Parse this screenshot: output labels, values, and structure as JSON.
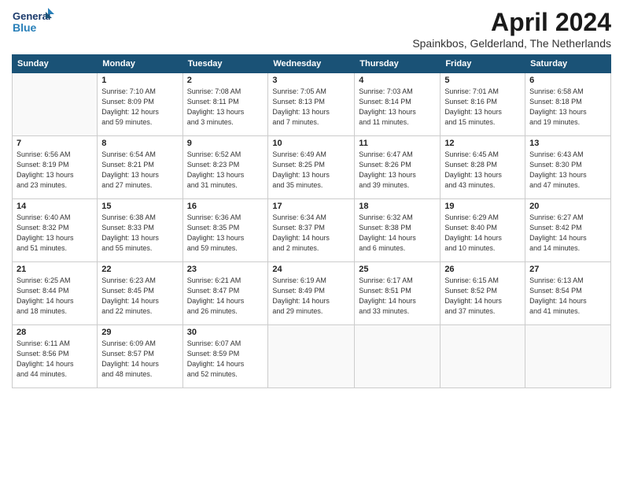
{
  "header": {
    "logo_line1": "General",
    "logo_line2": "Blue",
    "month": "April 2024",
    "location": "Spainkbos, Gelderland, The Netherlands"
  },
  "days_of_week": [
    "Sunday",
    "Monday",
    "Tuesday",
    "Wednesday",
    "Thursday",
    "Friday",
    "Saturday"
  ],
  "weeks": [
    [
      {
        "day": "",
        "info": ""
      },
      {
        "day": "1",
        "info": "Sunrise: 7:10 AM\nSunset: 8:09 PM\nDaylight: 12 hours\nand 59 minutes."
      },
      {
        "day": "2",
        "info": "Sunrise: 7:08 AM\nSunset: 8:11 PM\nDaylight: 13 hours\nand 3 minutes."
      },
      {
        "day": "3",
        "info": "Sunrise: 7:05 AM\nSunset: 8:13 PM\nDaylight: 13 hours\nand 7 minutes."
      },
      {
        "day": "4",
        "info": "Sunrise: 7:03 AM\nSunset: 8:14 PM\nDaylight: 13 hours\nand 11 minutes."
      },
      {
        "day": "5",
        "info": "Sunrise: 7:01 AM\nSunset: 8:16 PM\nDaylight: 13 hours\nand 15 minutes."
      },
      {
        "day": "6",
        "info": "Sunrise: 6:58 AM\nSunset: 8:18 PM\nDaylight: 13 hours\nand 19 minutes."
      }
    ],
    [
      {
        "day": "7",
        "info": "Sunrise: 6:56 AM\nSunset: 8:19 PM\nDaylight: 13 hours\nand 23 minutes."
      },
      {
        "day": "8",
        "info": "Sunrise: 6:54 AM\nSunset: 8:21 PM\nDaylight: 13 hours\nand 27 minutes."
      },
      {
        "day": "9",
        "info": "Sunrise: 6:52 AM\nSunset: 8:23 PM\nDaylight: 13 hours\nand 31 minutes."
      },
      {
        "day": "10",
        "info": "Sunrise: 6:49 AM\nSunset: 8:25 PM\nDaylight: 13 hours\nand 35 minutes."
      },
      {
        "day": "11",
        "info": "Sunrise: 6:47 AM\nSunset: 8:26 PM\nDaylight: 13 hours\nand 39 minutes."
      },
      {
        "day": "12",
        "info": "Sunrise: 6:45 AM\nSunset: 8:28 PM\nDaylight: 13 hours\nand 43 minutes."
      },
      {
        "day": "13",
        "info": "Sunrise: 6:43 AM\nSunset: 8:30 PM\nDaylight: 13 hours\nand 47 minutes."
      }
    ],
    [
      {
        "day": "14",
        "info": "Sunrise: 6:40 AM\nSunset: 8:32 PM\nDaylight: 13 hours\nand 51 minutes."
      },
      {
        "day": "15",
        "info": "Sunrise: 6:38 AM\nSunset: 8:33 PM\nDaylight: 13 hours\nand 55 minutes."
      },
      {
        "day": "16",
        "info": "Sunrise: 6:36 AM\nSunset: 8:35 PM\nDaylight: 13 hours\nand 59 minutes."
      },
      {
        "day": "17",
        "info": "Sunrise: 6:34 AM\nSunset: 8:37 PM\nDaylight: 14 hours\nand 2 minutes."
      },
      {
        "day": "18",
        "info": "Sunrise: 6:32 AM\nSunset: 8:38 PM\nDaylight: 14 hours\nand 6 minutes."
      },
      {
        "day": "19",
        "info": "Sunrise: 6:29 AM\nSunset: 8:40 PM\nDaylight: 14 hours\nand 10 minutes."
      },
      {
        "day": "20",
        "info": "Sunrise: 6:27 AM\nSunset: 8:42 PM\nDaylight: 14 hours\nand 14 minutes."
      }
    ],
    [
      {
        "day": "21",
        "info": "Sunrise: 6:25 AM\nSunset: 8:44 PM\nDaylight: 14 hours\nand 18 minutes."
      },
      {
        "day": "22",
        "info": "Sunrise: 6:23 AM\nSunset: 8:45 PM\nDaylight: 14 hours\nand 22 minutes."
      },
      {
        "day": "23",
        "info": "Sunrise: 6:21 AM\nSunset: 8:47 PM\nDaylight: 14 hours\nand 26 minutes."
      },
      {
        "day": "24",
        "info": "Sunrise: 6:19 AM\nSunset: 8:49 PM\nDaylight: 14 hours\nand 29 minutes."
      },
      {
        "day": "25",
        "info": "Sunrise: 6:17 AM\nSunset: 8:51 PM\nDaylight: 14 hours\nand 33 minutes."
      },
      {
        "day": "26",
        "info": "Sunrise: 6:15 AM\nSunset: 8:52 PM\nDaylight: 14 hours\nand 37 minutes."
      },
      {
        "day": "27",
        "info": "Sunrise: 6:13 AM\nSunset: 8:54 PM\nDaylight: 14 hours\nand 41 minutes."
      }
    ],
    [
      {
        "day": "28",
        "info": "Sunrise: 6:11 AM\nSunset: 8:56 PM\nDaylight: 14 hours\nand 44 minutes."
      },
      {
        "day": "29",
        "info": "Sunrise: 6:09 AM\nSunset: 8:57 PM\nDaylight: 14 hours\nand 48 minutes."
      },
      {
        "day": "30",
        "info": "Sunrise: 6:07 AM\nSunset: 8:59 PM\nDaylight: 14 hours\nand 52 minutes."
      },
      {
        "day": "",
        "info": ""
      },
      {
        "day": "",
        "info": ""
      },
      {
        "day": "",
        "info": ""
      },
      {
        "day": "",
        "info": ""
      }
    ]
  ]
}
